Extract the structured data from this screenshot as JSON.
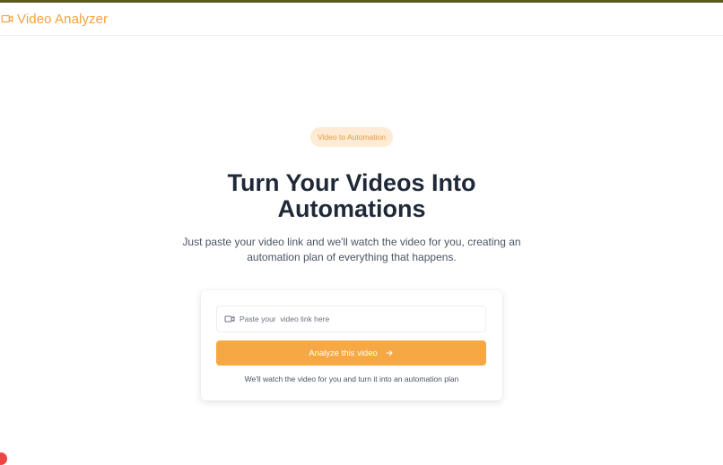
{
  "app": {
    "title": "Video Analyzer",
    "brand_icon": "video-camera-icon",
    "accent_color": "#f5a23c"
  },
  "hero": {
    "badge": "Video to Automation",
    "headline_line1": "Turn Your Videos Into",
    "headline_line2": "Automations",
    "subtitle_line1": "Just paste your video link and we'll watch the video for you, creating an",
    "subtitle_line2": "automation plan of everything that happens."
  },
  "form": {
    "input_icon": "video-camera-icon",
    "input_placeholder": "Paste your  video link here",
    "input_value": "",
    "button_label": "Analyze this video",
    "button_icon": "arrow-right-icon",
    "button_color": "#f5a843",
    "helper_text": "We'll watch the video for you and turn it into an automation plan"
  }
}
